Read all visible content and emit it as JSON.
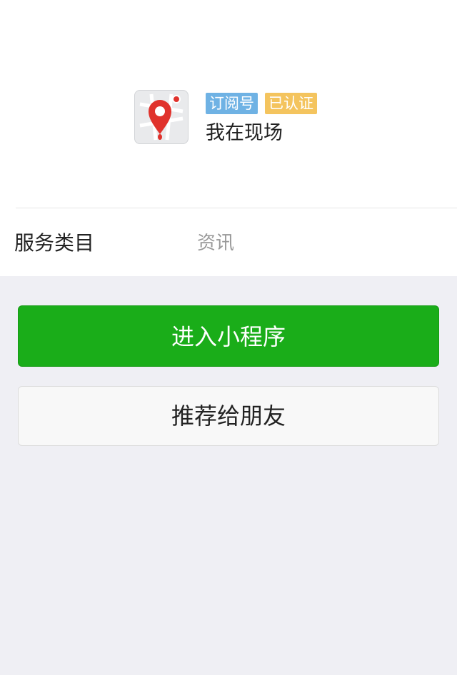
{
  "account": {
    "logo_icon": "map-pin-icon",
    "tags": [
      "订阅号",
      "已认证"
    ],
    "tag_colors": [
      "#6fb2e4",
      "#f4c45e"
    ],
    "name": "我在现场"
  },
  "info": {
    "label": "服务类目",
    "value": "资讯"
  },
  "actions": {
    "primary_label": "进入小程序",
    "secondary_label": "推荐给朋友",
    "primary_color": "#1aad19"
  }
}
